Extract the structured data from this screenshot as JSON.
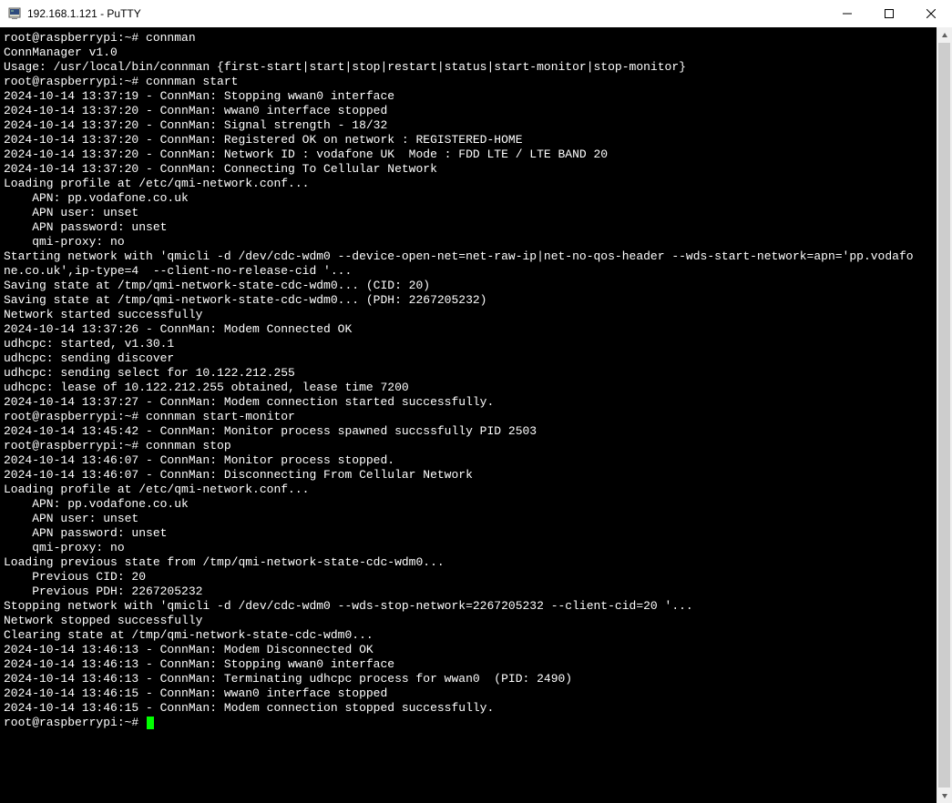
{
  "window": {
    "title": "192.168.1.121 - PuTTY"
  },
  "terminal": {
    "prompt": "root@raspberrypi:~#",
    "lines": [
      {
        "type": "cmd",
        "text": "root@raspberrypi:~# connman"
      },
      {
        "type": "out",
        "text": "ConnManager v1.0"
      },
      {
        "type": "out",
        "text": "Usage: /usr/local/bin/connman {first-start|start|stop|restart|status|start-monitor|stop-monitor}"
      },
      {
        "type": "cmd",
        "text": "root@raspberrypi:~# connman start"
      },
      {
        "type": "out",
        "text": "2024-10-14 13:37:19 - ConnMan: Stopping wwan0 interface"
      },
      {
        "type": "out",
        "text": "2024-10-14 13:37:20 - ConnMan: wwan0 interface stopped"
      },
      {
        "type": "out",
        "text": "2024-10-14 13:37:20 - ConnMan: Signal strength - 18/32"
      },
      {
        "type": "out",
        "text": "2024-10-14 13:37:20 - ConnMan: Registered OK on network : REGISTERED-HOME"
      },
      {
        "type": "out",
        "text": "2024-10-14 13:37:20 - ConnMan: Network ID : vodafone UK  Mode : FDD LTE / LTE BAND 20"
      },
      {
        "type": "out",
        "text": "2024-10-14 13:37:20 - ConnMan: Connecting To Cellular Network"
      },
      {
        "type": "out",
        "text": "Loading profile at /etc/qmi-network.conf..."
      },
      {
        "type": "out",
        "text": "    APN: pp.vodafone.co.uk"
      },
      {
        "type": "out",
        "text": "    APN user: unset"
      },
      {
        "type": "out",
        "text": "    APN password: unset"
      },
      {
        "type": "out",
        "text": "    qmi-proxy: no"
      },
      {
        "type": "out",
        "text": "Starting network with 'qmicli -d /dev/cdc-wdm0 --device-open-net=net-raw-ip|net-no-qos-header --wds-start-network=apn='pp.vodafo"
      },
      {
        "type": "out",
        "text": "ne.co.uk',ip-type=4  --client-no-release-cid '..."
      },
      {
        "type": "out",
        "text": "Saving state at /tmp/qmi-network-state-cdc-wdm0... (CID: 20)"
      },
      {
        "type": "out",
        "text": "Saving state at /tmp/qmi-network-state-cdc-wdm0... (PDH: 2267205232)"
      },
      {
        "type": "out",
        "text": "Network started successfully"
      },
      {
        "type": "out",
        "text": "2024-10-14 13:37:26 - ConnMan: Modem Connected OK"
      },
      {
        "type": "out",
        "text": "udhcpc: started, v1.30.1"
      },
      {
        "type": "out",
        "text": "udhcpc: sending discover"
      },
      {
        "type": "out",
        "text": "udhcpc: sending select for 10.122.212.255"
      },
      {
        "type": "out",
        "text": "udhcpc: lease of 10.122.212.255 obtained, lease time 7200"
      },
      {
        "type": "out",
        "text": "2024-10-14 13:37:27 - ConnMan: Modem connection started successfully."
      },
      {
        "type": "cmd",
        "text": "root@raspberrypi:~# connman start-monitor"
      },
      {
        "type": "out",
        "text": "2024-10-14 13:45:42 - ConnMan: Monitor process spawned succssfully PID 2503"
      },
      {
        "type": "cmd",
        "text": "root@raspberrypi:~# connman stop"
      },
      {
        "type": "out",
        "text": "2024-10-14 13:46:07 - ConnMan: Monitor process stopped."
      },
      {
        "type": "out",
        "text": "2024-10-14 13:46:07 - ConnMan: Disconnecting From Cellular Network"
      },
      {
        "type": "out",
        "text": "Loading profile at /etc/qmi-network.conf..."
      },
      {
        "type": "out",
        "text": "    APN: pp.vodafone.co.uk"
      },
      {
        "type": "out",
        "text": "    APN user: unset"
      },
      {
        "type": "out",
        "text": "    APN password: unset"
      },
      {
        "type": "out",
        "text": "    qmi-proxy: no"
      },
      {
        "type": "out",
        "text": "Loading previous state from /tmp/qmi-network-state-cdc-wdm0..."
      },
      {
        "type": "out",
        "text": "    Previous CID: 20"
      },
      {
        "type": "out",
        "text": "    Previous PDH: 2267205232"
      },
      {
        "type": "out",
        "text": "Stopping network with 'qmicli -d /dev/cdc-wdm0 --wds-stop-network=2267205232 --client-cid=20 '..."
      },
      {
        "type": "out",
        "text": "Network stopped successfully"
      },
      {
        "type": "out",
        "text": "Clearing state at /tmp/qmi-network-state-cdc-wdm0..."
      },
      {
        "type": "out",
        "text": "2024-10-14 13:46:13 - ConnMan: Modem Disconnected OK"
      },
      {
        "type": "out",
        "text": "2024-10-14 13:46:13 - ConnMan: Stopping wwan0 interface"
      },
      {
        "type": "out",
        "text": "2024-10-14 13:46:13 - ConnMan: Terminating udhcpc process for wwan0  (PID: 2490)"
      },
      {
        "type": "out",
        "text": "2024-10-14 13:46:15 - ConnMan: wwan0 interface stopped"
      },
      {
        "type": "out",
        "text": "2024-10-14 13:46:15 - ConnMan: Modem connection stopped successfully."
      }
    ],
    "final_prompt": "root@raspberrypi:~# "
  }
}
